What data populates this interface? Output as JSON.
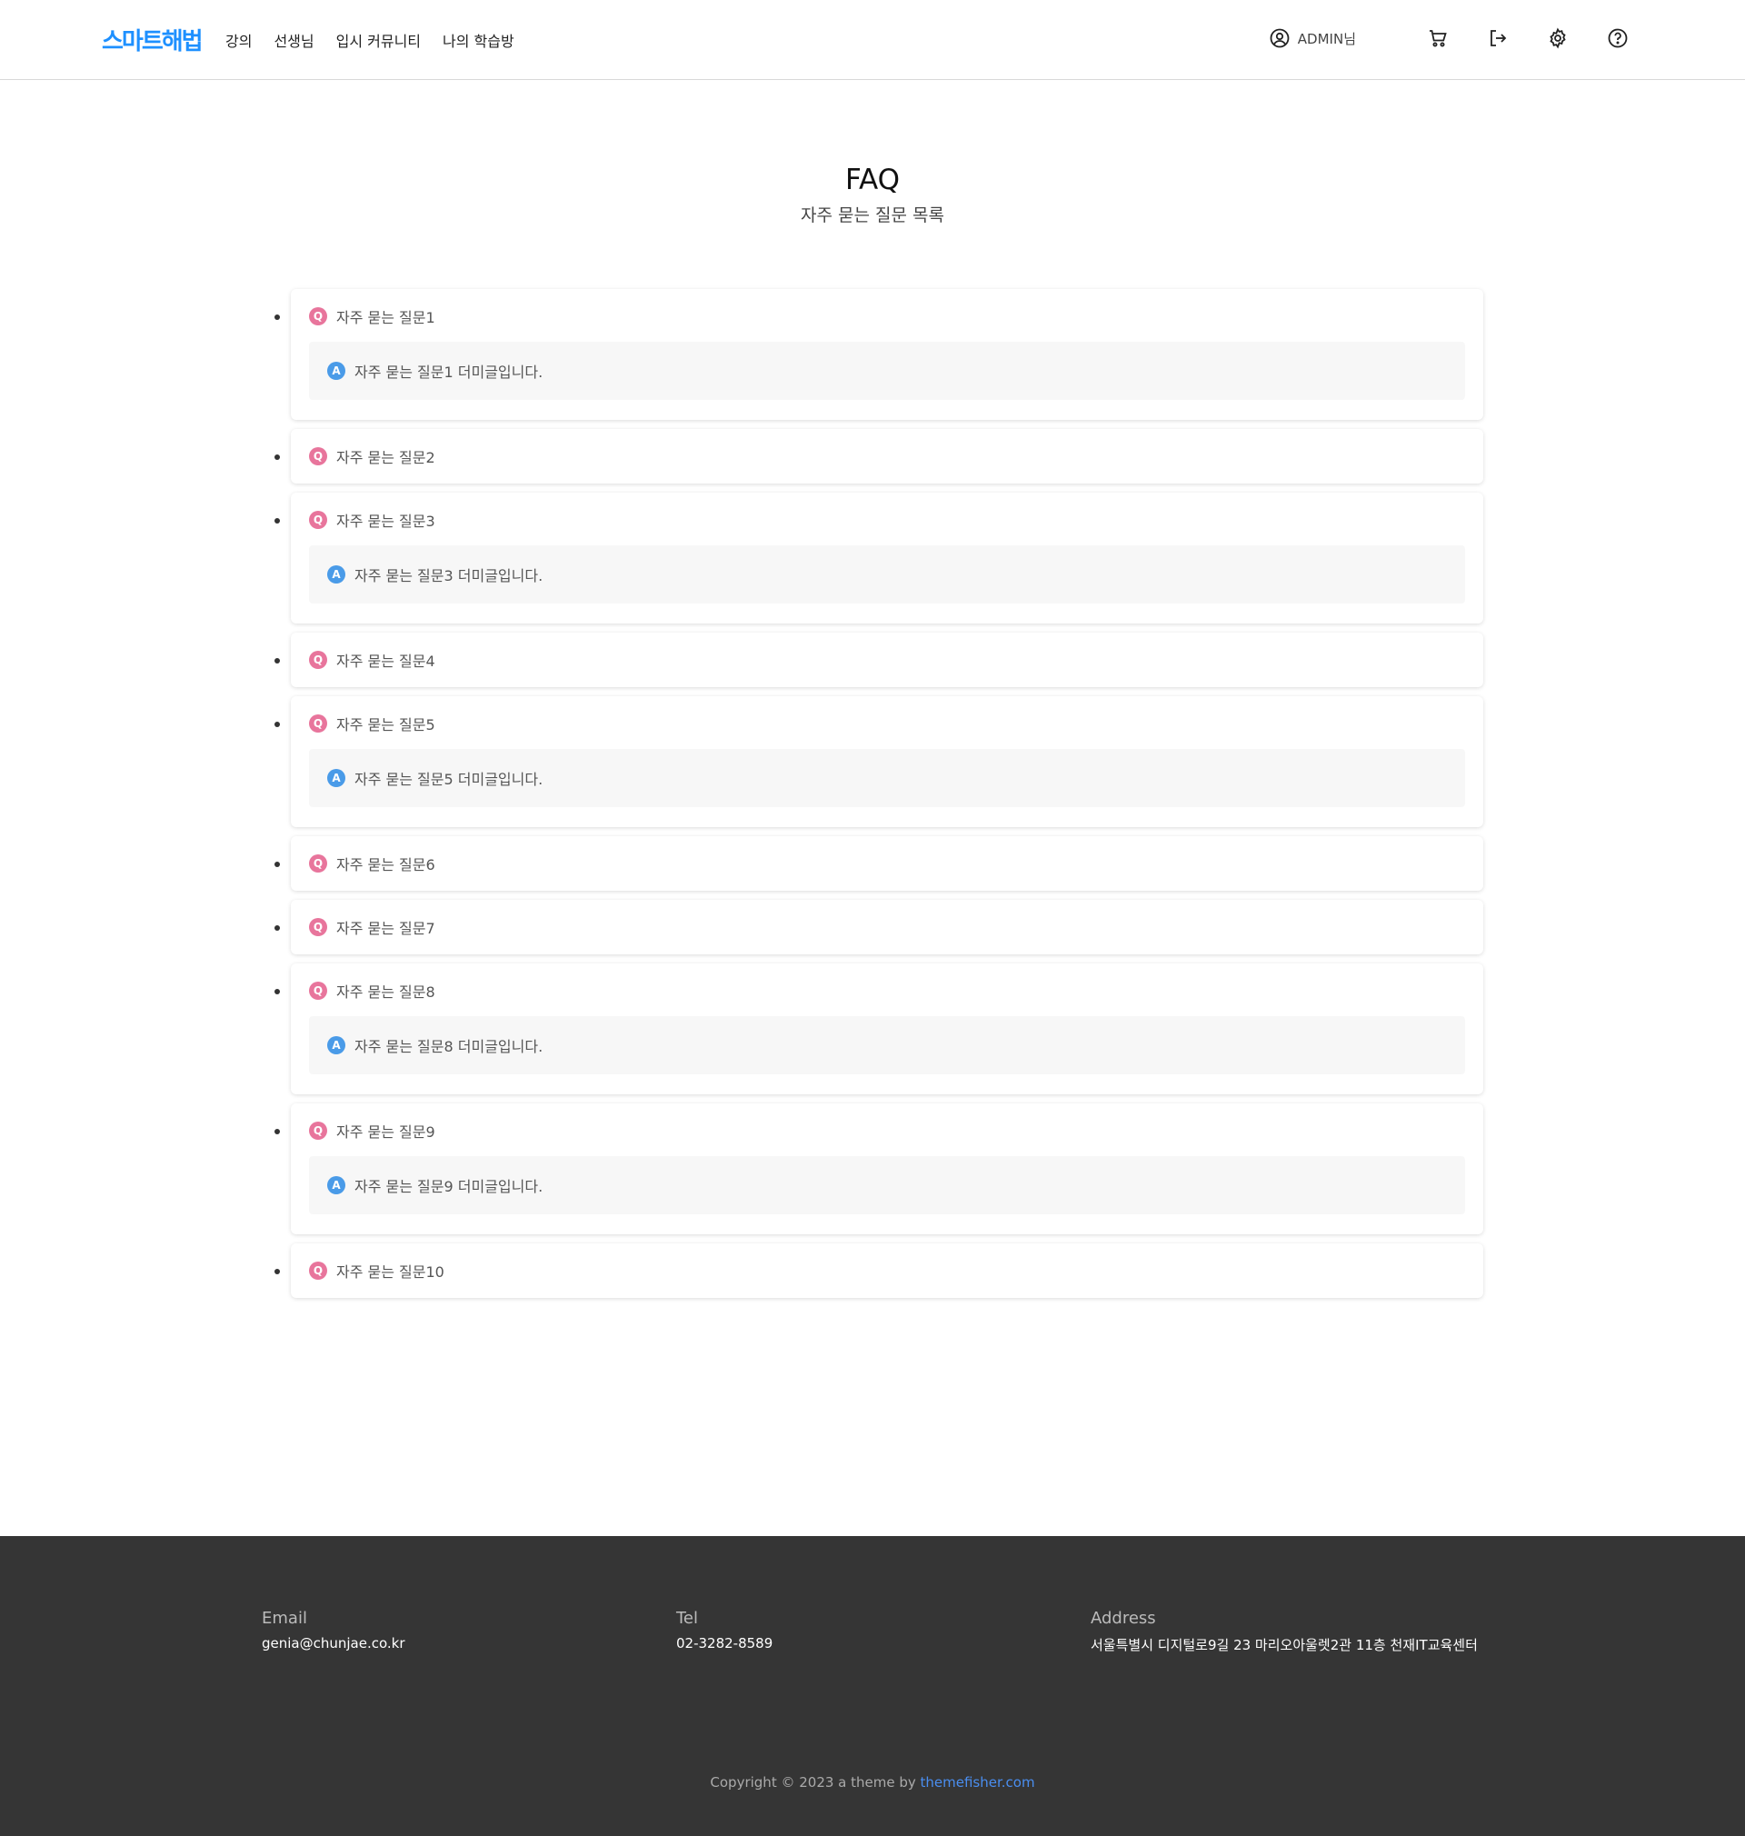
{
  "header": {
    "logo_text": "스마트해법",
    "nav": [
      "강의",
      "선생님",
      "입시 커뮤니티",
      "나의 학습방"
    ],
    "user_label": "ADMIN님"
  },
  "title": {
    "heading": "FAQ",
    "subheading": "자주 묻는 질문 목록"
  },
  "faq": [
    {
      "q": "자주 묻는 질문1",
      "a": "자주 묻는 질문1 더미글입니다.",
      "open": true
    },
    {
      "q": "자주 묻는 질문2",
      "a": "",
      "open": false
    },
    {
      "q": "자주 묻는 질문3",
      "a": "자주 묻는 질문3 더미글입니다.",
      "open": true
    },
    {
      "q": "자주 묻는 질문4",
      "a": "",
      "open": false
    },
    {
      "q": "자주 묻는 질문5",
      "a": "자주 묻는 질문5 더미글입니다.",
      "open": true
    },
    {
      "q": "자주 묻는 질문6",
      "a": "",
      "open": false
    },
    {
      "q": "자주 묻는 질문7",
      "a": "",
      "open": false
    },
    {
      "q": "자주 묻는 질문8",
      "a": "자주 묻는 질문8 더미글입니다.",
      "open": true
    },
    {
      "q": "자주 묻는 질문9",
      "a": "자주 묻는 질문9 더미글입니다.",
      "open": true
    },
    {
      "q": "자주 묻는 질문10",
      "a": "",
      "open": false
    }
  ],
  "badges": {
    "q": "Q",
    "a": "A"
  },
  "footer": {
    "email_label": "Email",
    "email": "genia@chunjae.co.kr",
    "tel_label": "Tel",
    "tel": "02-3282-8589",
    "address_label": "Address",
    "address": "서울특별시 디지털로9길 23 마리오아울렛2관 11층 천재IT교육센터",
    "copyright_prefix": "Copyright © 2023 a theme by ",
    "copyright_link": "themefisher.com"
  },
  "colors": {
    "logo": "#1e90ff",
    "q_badge": "#e8759c",
    "a_badge": "#4a9be8",
    "footer_bg": "#353535",
    "link": "#4a8ef0"
  },
  "icons": [
    "user-circle-icon",
    "cart-icon",
    "logout-icon",
    "gear-icon",
    "help-icon"
  ]
}
